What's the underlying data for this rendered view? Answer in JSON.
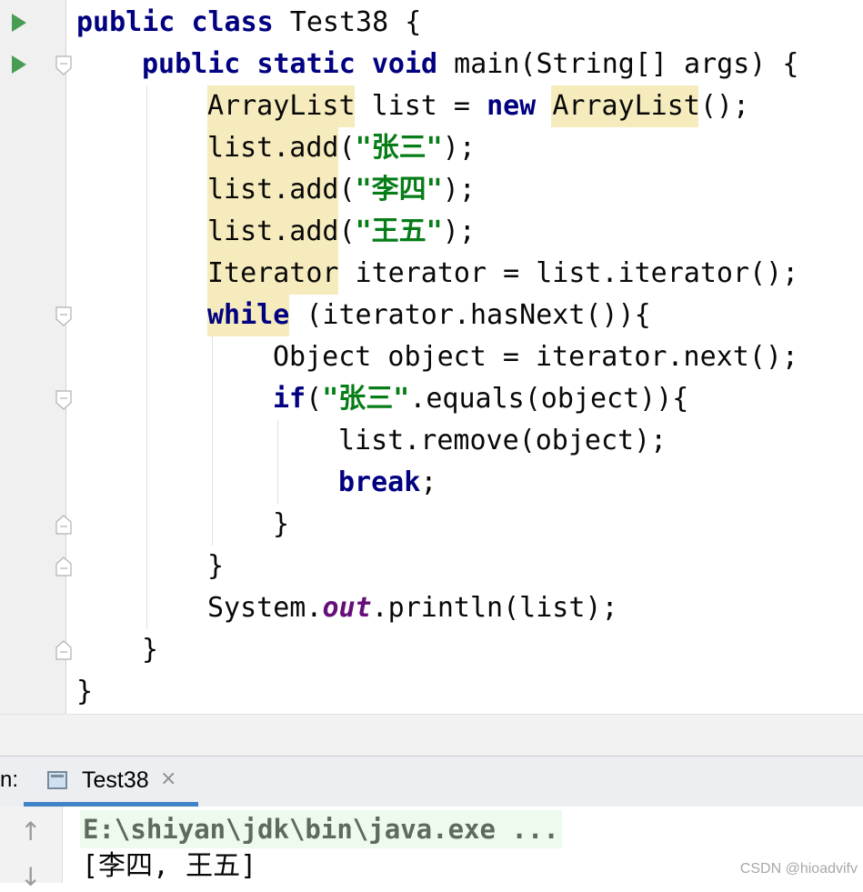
{
  "editor": {
    "lines": [
      {
        "kw1": "public",
        "kw2": "class",
        "rest": " Test38 {"
      },
      {
        "kw1": "public",
        "kw2": "static",
        "kw3": "void",
        "rest": " main(String[] args) {"
      },
      {
        "t1": "ArrayList",
        "t2": " list = ",
        "kw": "new",
        "t3": " ",
        "t4": "ArrayList",
        "t5": "();"
      },
      {
        "a": "list.add",
        "b": "(",
        "s": "\"张三\"",
        "c": ");"
      },
      {
        "a": "list.add",
        "b": "(",
        "s": "\"李四\"",
        "c": ");"
      },
      {
        "a": "list.add",
        "b": "(",
        "s": "\"王五\"",
        "c": ");"
      },
      {
        "a": "Iterator",
        "b": " iterator = list.iterator();"
      },
      {
        "kw": "while",
        "rest": " (iterator.hasNext()){"
      },
      {
        "text": "Object object = iterator.next();"
      },
      {
        "kw": "if",
        "b": "(",
        "s": "\"张三\"",
        "rest": ".equals(object)){"
      },
      {
        "text": "list.remove(object);"
      },
      {
        "kw": "break",
        "rest": ";"
      },
      {
        "text": "}"
      },
      {
        "text": "}"
      },
      {
        "a": "System.",
        "stat": "out",
        "rest": ".println(list);"
      },
      {
        "text": "}"
      },
      {
        "text": "}"
      }
    ]
  },
  "run_panel": {
    "label": "n:",
    "tab_label": "Test38",
    "tab_close": "×"
  },
  "console": {
    "command": "E:\\shiyan\\jdk\\bin\\java.exe ...",
    "output": "[李四, 王五]"
  },
  "watermark": "CSDN @hioadvifv",
  "colors": {
    "keyword": "#000080",
    "string": "#067d17",
    "static_field": "#660e7a",
    "highlight": "#f6ebbc",
    "run_icon": "#499c54",
    "tab_underline": "#4083c9"
  },
  "icons": {
    "gutter_run": "run-triangle-icon",
    "gutter_fold": "fold-marker-icon",
    "tab": "console-tab-icon",
    "scroll_up": "arrow-up-icon",
    "scroll_down": "arrow-down-icon"
  }
}
